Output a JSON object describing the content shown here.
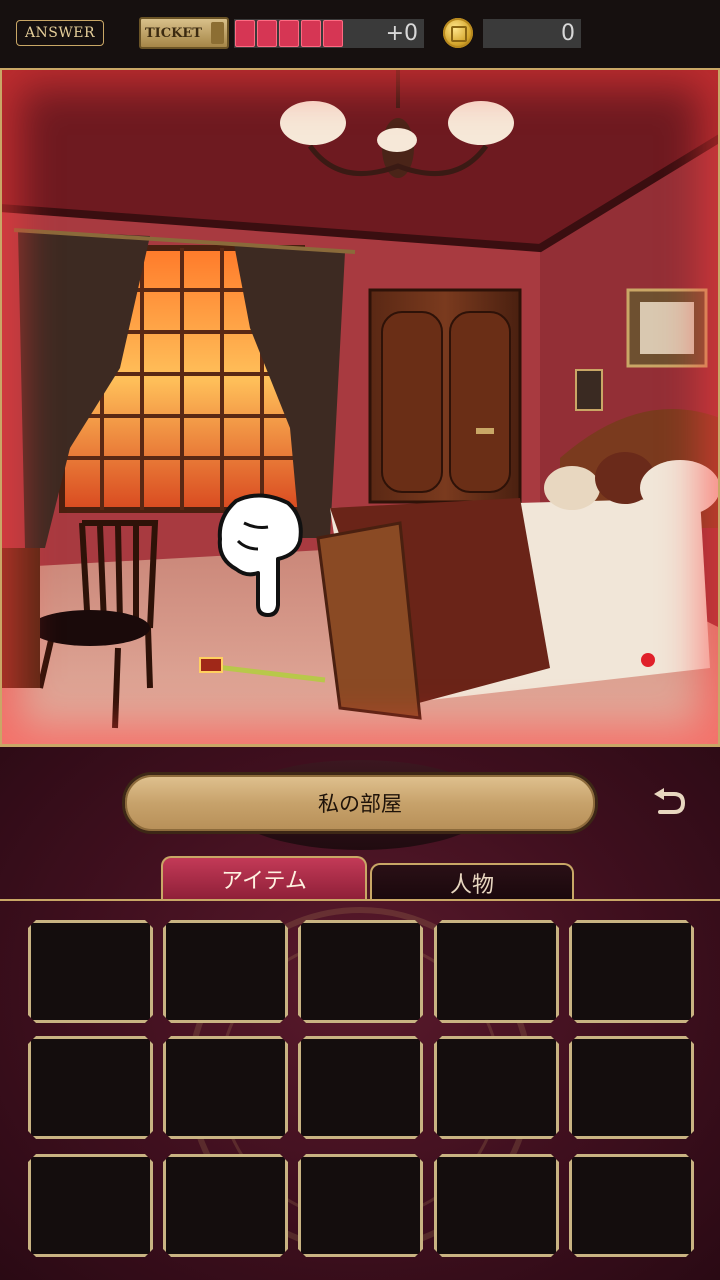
{
  "hud": {
    "answer_label": "ANSWER",
    "ticket_label": "TICKET",
    "ticket_pips": 5,
    "ticket_count": "+0",
    "coin_count": "0"
  },
  "scene": {
    "room_name": "私の部屋",
    "hint_icon": "pointing-hand-icon"
  },
  "tabs": {
    "items_label": "アイテム",
    "people_label": "人物",
    "active": "items"
  },
  "inventory": {
    "slot_count": 15
  },
  "colors": {
    "accent_gold": "#c9a766",
    "active_tab": "#c33a57",
    "ticket_pip": "#d63654"
  }
}
